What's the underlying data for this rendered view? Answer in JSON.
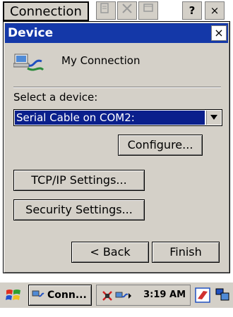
{
  "parent_window": {
    "title": "Connection",
    "help_label": "?",
    "close_label": "×"
  },
  "dialog": {
    "title": "Device",
    "close_label": "×",
    "connection_name": "My Connection",
    "select_label": "Select a device:",
    "selected_device": "Serial Cable on COM2:",
    "buttons": {
      "configure": "Configure...",
      "tcpip": "TCP/IP Settings...",
      "security": "Security Settings...",
      "back": "< Back",
      "finish": "Finish"
    }
  },
  "taskbar": {
    "task_label": "Conn...",
    "clock": "3:19 AM"
  },
  "colors": {
    "titlebar": "#1438a8",
    "selection": "#0a1f8c",
    "face": "#d4d0c8"
  }
}
